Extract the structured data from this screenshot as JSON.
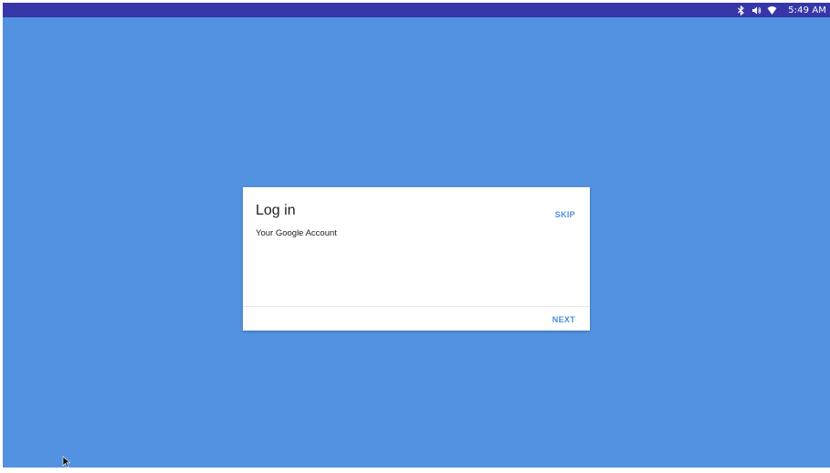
{
  "status_bar": {
    "time": "5:49 AM",
    "icons": [
      "bluetooth-icon",
      "volume-icon",
      "wifi-icon"
    ]
  },
  "dialog": {
    "title": "Log in",
    "subtitle": "Your Google Account",
    "skip_label": "SKIP",
    "next_label": "NEXT"
  },
  "colors": {
    "background": "#5292e0",
    "status_bar": "#3736a8",
    "accent": "#4a8fd8",
    "dialog": "#ffffff"
  }
}
